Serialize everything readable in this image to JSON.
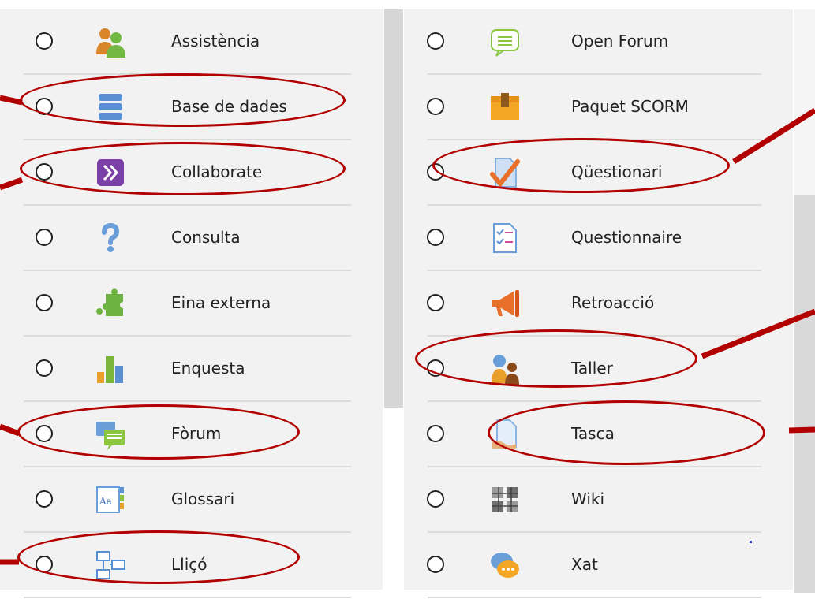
{
  "left_column": [
    {
      "label": "Assistència",
      "icon": "attendance-icon",
      "highlighted": false
    },
    {
      "label": "Base de dades",
      "icon": "database-icon",
      "highlighted": true
    },
    {
      "label": "Collaborate",
      "icon": "collaborate-icon",
      "highlighted": true
    },
    {
      "label": "Consulta",
      "icon": "question-mark-icon",
      "highlighted": false
    },
    {
      "label": "Eina externa",
      "icon": "puzzle-icon",
      "highlighted": false
    },
    {
      "label": "Enquesta",
      "icon": "bar-chart-icon",
      "highlighted": false
    },
    {
      "label": "Fòrum",
      "icon": "forum-icon",
      "highlighted": true
    },
    {
      "label": "Glossari",
      "icon": "glossary-icon",
      "highlighted": false
    },
    {
      "label": "Lliçó",
      "icon": "lesson-icon",
      "highlighted": true
    }
  ],
  "right_column": [
    {
      "label": "Open Forum",
      "icon": "chat-bubble-icon",
      "highlighted": false
    },
    {
      "label": "Paquet SCORM",
      "icon": "package-icon",
      "highlighted": false
    },
    {
      "label": "Qüestionari",
      "icon": "quiz-checkmark-icon",
      "highlighted": true
    },
    {
      "label": "Questionnaire",
      "icon": "questionnaire-icon",
      "highlighted": false
    },
    {
      "label": "Retroacció",
      "icon": "megaphone-icon",
      "highlighted": false
    },
    {
      "label": "Taller",
      "icon": "workshop-icon",
      "highlighted": true
    },
    {
      "label": "Tasca",
      "icon": "assignment-icon",
      "highlighted": true
    },
    {
      "label": "Wiki",
      "icon": "wiki-icon",
      "highlighted": false
    },
    {
      "label": "Xat",
      "icon": "chat-icon",
      "highlighted": false
    }
  ],
  "colors": {
    "highlight": "#b20000",
    "panel": "#f2f2f2",
    "scrollbar": "#d6d6d6"
  }
}
